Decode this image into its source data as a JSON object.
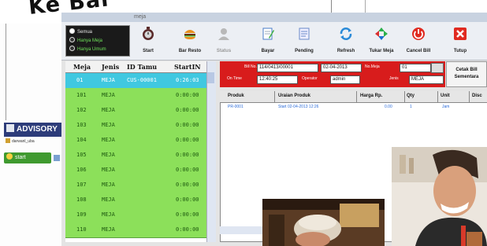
{
  "headline": "Ke Bar",
  "desktop": {
    "advisory_label": "ADVISORY",
    "user_label": "darwanl_uba",
    "start_label": "start"
  },
  "window": {
    "title": "meja"
  },
  "mode_options": [
    {
      "label": "Semua",
      "selected": true
    },
    {
      "label": "Hanya Meja",
      "selected": false
    },
    {
      "label": "Hanya Umum",
      "selected": false
    }
  ],
  "toolbar": {
    "start": "Start",
    "bar_resto": "Bar Resto",
    "status": "Status",
    "bayar": "Bayar",
    "pending": "Pending",
    "refresh": "Refresh",
    "tukar_meja": "Tukar Meja",
    "cancel_bill": "Cancel Bill",
    "tutup": "Tutup"
  },
  "grid": {
    "headers": [
      "Meja",
      "Jenis",
      "ID Tamu",
      "StartIN"
    ],
    "rows": [
      {
        "meja": "01",
        "jenis": "MEJA",
        "id": "CUS-00001",
        "start": "0:26:03",
        "selected": true
      },
      {
        "meja": "101",
        "jenis": "MEJA",
        "id": "",
        "start": "0:00:00",
        "selected": false
      },
      {
        "meja": "102",
        "jenis": "MEJA",
        "id": "",
        "start": "0:00:00",
        "selected": false
      },
      {
        "meja": "103",
        "jenis": "MEJA",
        "id": "",
        "start": "0:00:00",
        "selected": false
      },
      {
        "meja": "104",
        "jenis": "MEJA",
        "id": "",
        "start": "0:00:00",
        "selected": false
      },
      {
        "meja": "105",
        "jenis": "MEJA",
        "id": "",
        "start": "0:00:00",
        "selected": false
      },
      {
        "meja": "106",
        "jenis": "MEJA",
        "id": "",
        "start": "0:00:00",
        "selected": false
      },
      {
        "meja": "107",
        "jenis": "MEJA",
        "id": "",
        "start": "0:00:00",
        "selected": false
      },
      {
        "meja": "108",
        "jenis": "MEJA",
        "id": "",
        "start": "0:00:00",
        "selected": false
      },
      {
        "meja": "109",
        "jenis": "MEJA",
        "id": "",
        "start": "0:00:00",
        "selected": false
      },
      {
        "meja": "110",
        "jenis": "MEJA",
        "id": "",
        "start": "0:00:00",
        "selected": false
      }
    ]
  },
  "info": {
    "bill_no_label": "Bill No.",
    "bill_no": "114/0413/00001",
    "date": "02-04-2013",
    "no_meja_label": "No.Meja",
    "no_meja": "01",
    "on_time_label": "On Time",
    "on_time": "12:40:25",
    "operator_label": "Operator",
    "operator": "admin",
    "jenis_label": "Jenis",
    "jenis": "MEJA",
    "cetak_label": "Cetak Bill Sementara"
  },
  "products": {
    "headers": [
      "Produk",
      "Uraian Produk",
      "Harga Rp.",
      "Qty",
      "Unit",
      "Disc"
    ],
    "rows": [
      {
        "produk": "PR-0001",
        "uraian": "Start 02-04-2013 12:26",
        "harga": "0.00",
        "qty": "1",
        "unit": "Jam"
      }
    ]
  },
  "colors": {
    "grid_row": "#8ce05a",
    "grid_selected": "#40c8e0",
    "info_panel": "#d81c1c"
  }
}
